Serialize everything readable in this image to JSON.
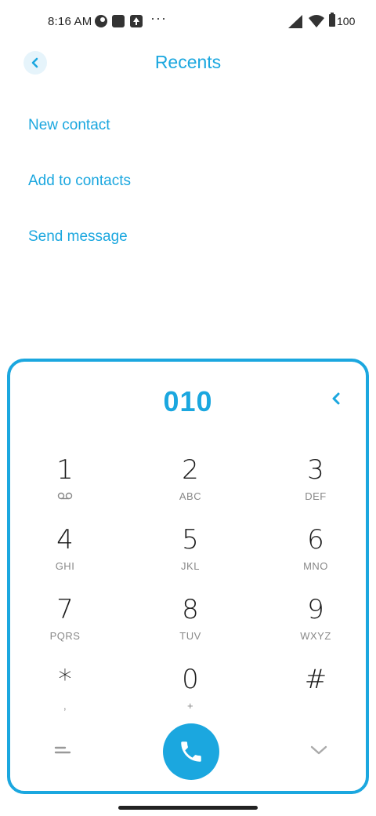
{
  "status_bar": {
    "time": "8:16 AM",
    "more": "···",
    "battery": "100",
    "icons": [
      "circle-app-icon",
      "square-app-icon",
      "upload-icon",
      "signal-icon",
      "wifi-icon",
      "battery-icon"
    ]
  },
  "header": {
    "title": "Recents",
    "back_icon": "chevron-left-icon"
  },
  "actions": [
    {
      "label": "New contact"
    },
    {
      "label": "Add to contacts"
    },
    {
      "label": "Send message"
    }
  ],
  "dialpad": {
    "number": "010",
    "keys": [
      {
        "digit": "1",
        "letters": ""
      },
      {
        "digit": "2",
        "letters": "ABC"
      },
      {
        "digit": "3",
        "letters": "DEF"
      },
      {
        "digit": "4",
        "letters": "GHI"
      },
      {
        "digit": "5",
        "letters": "JKL"
      },
      {
        "digit": "6",
        "letters": "MNO"
      },
      {
        "digit": "7",
        "letters": "PQRS"
      },
      {
        "digit": "8",
        "letters": "TUV"
      },
      {
        "digit": "9",
        "letters": "WXYZ"
      },
      {
        "digit": "*",
        "letters": ","
      },
      {
        "digit": "0",
        "letters": "+"
      },
      {
        "digit": "#",
        "letters": ""
      }
    ],
    "icons": [
      "voicemail-icon",
      "backspace-icon",
      "phone-icon",
      "menu-icon",
      "chevron-down-icon"
    ]
  },
  "colors": {
    "accent": "#1ba7df",
    "accent_light": "#e6f4fb"
  }
}
